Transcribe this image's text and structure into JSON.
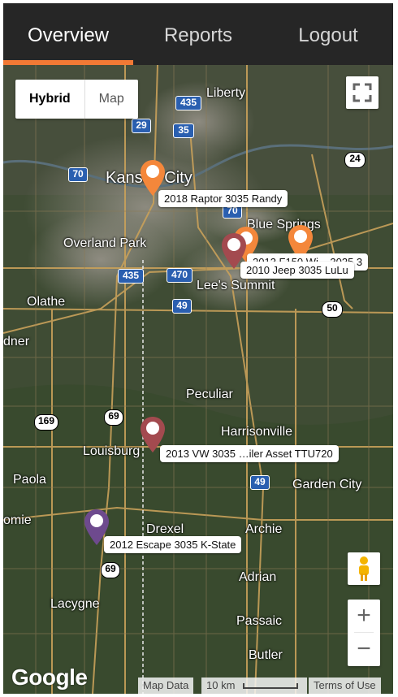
{
  "nav": {
    "tabs": [
      {
        "label": "Overview",
        "active": true
      },
      {
        "label": "Reports",
        "active": false
      },
      {
        "label": "Logout",
        "active": false
      }
    ],
    "accent_color": "#f27935"
  },
  "map": {
    "type_control": {
      "options": [
        "Hybrid",
        "Map"
      ],
      "selected": "Hybrid"
    },
    "zoom": {
      "in_label": "+",
      "out_label": "−"
    },
    "logo": "Google",
    "attribution": {
      "data": "Map Data",
      "scale": "10 km",
      "terms": "Terms of Use"
    },
    "places": [
      {
        "name": "Liberty"
      },
      {
        "name": "Kansas City"
      },
      {
        "name": "Blue Springs"
      },
      {
        "name": "Overland Park"
      },
      {
        "name": "Lee's Summit"
      },
      {
        "name": "Olathe"
      },
      {
        "name": "Peculiar"
      },
      {
        "name": "Harrisonville"
      },
      {
        "name": "Louisburg"
      },
      {
        "name": "Paola"
      },
      {
        "name": "Garden City"
      },
      {
        "name": "Drexel"
      },
      {
        "name": "Archie"
      },
      {
        "name": "Adrian"
      },
      {
        "name": "Lacygne"
      },
      {
        "name": "Passaic"
      },
      {
        "name": "Butler"
      },
      {
        "name": "dner"
      },
      {
        "name": "omie"
      }
    ],
    "highways": [
      "29",
      "35",
      "435",
      "70",
      "24",
      "70",
      "435",
      "470",
      "49",
      "50",
      "169",
      "69",
      "49",
      "69"
    ],
    "markers": [
      {
        "label": "2018 Raptor 3035 Randy",
        "color": "#f4873b"
      },
      {
        "label": "2010 Jeep 3035 LuLu",
        "color": "#a34a4f"
      },
      {
        "label": "2013 VW 3035 …iler Asset TTU720",
        "color": "#a34a4f"
      },
      {
        "label": "2012 Escape 3035 K-State",
        "color": "#6e4a8e"
      },
      {
        "label": "2013 F150 Wi... 3035 3",
        "color": "#f4873b"
      }
    ]
  }
}
